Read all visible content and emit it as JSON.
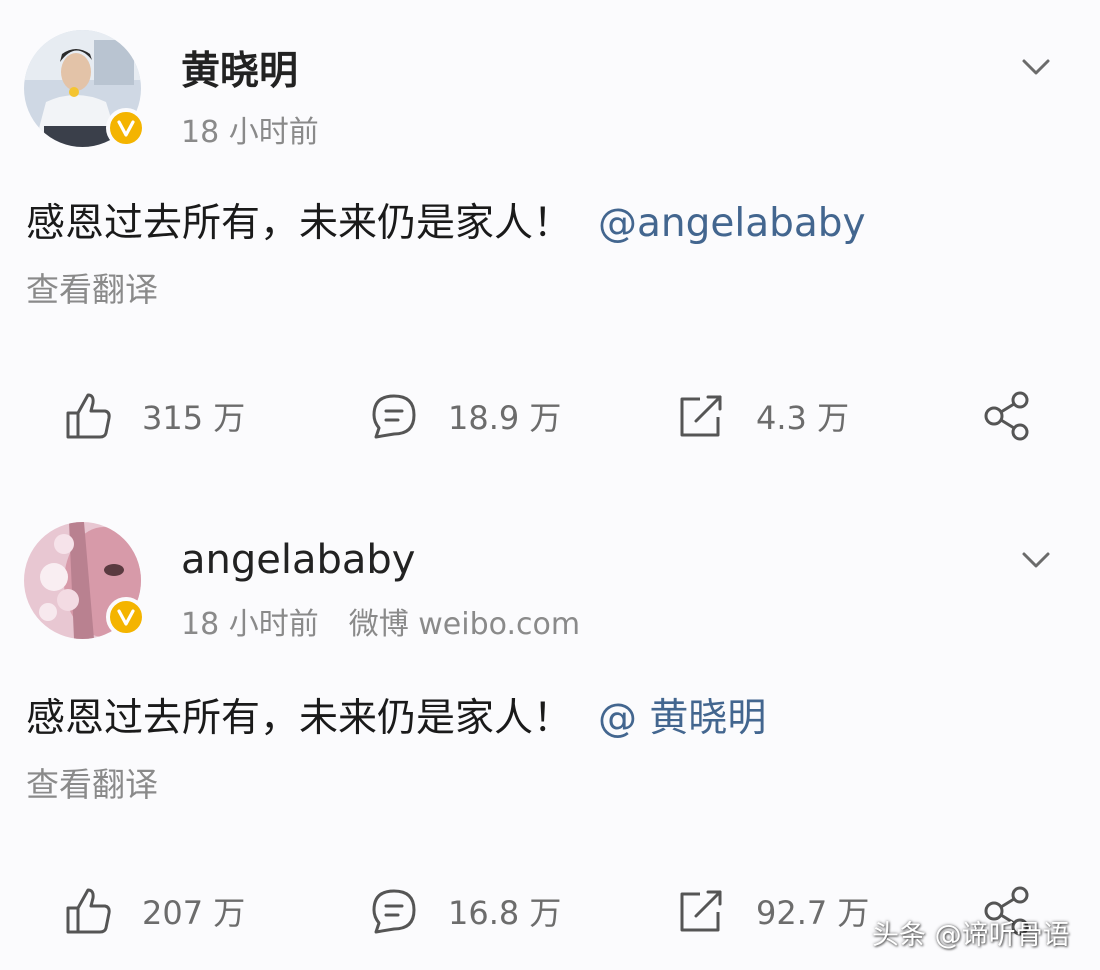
{
  "posts": [
    {
      "username": "黄晓明",
      "time": "18 小时前",
      "source": "",
      "content": "感恩过去所有，未来仍是家人！",
      "mention": "@angelababy",
      "translate_label": "查看翻译",
      "likes": "315 万",
      "comments": "18.9 万",
      "reposts": "4.3 万",
      "avatar_icon": "avatar-photo-man",
      "verified_badge_color": "#f4b400"
    },
    {
      "username": "angelababy",
      "time": "18 小时前",
      "source": "微博 weibo.com",
      "content": "感恩过去所有，未来仍是家人！",
      "mention": "@ 黄晓明",
      "translate_label": "查看翻译",
      "likes": "207 万",
      "comments": "16.8 万",
      "reposts": "92.7 万",
      "avatar_icon": "avatar-photo-woman",
      "verified_badge_color": "#f4b400"
    }
  ],
  "icons": {
    "like": "thumbs-up-icon",
    "comment": "comment-bubble-icon",
    "repost": "repost-arrow-icon",
    "share": "share-icon",
    "menu": "chevron-down-icon"
  },
  "colors": {
    "mention": "#43668f",
    "muted_text": "#8a8a8a",
    "badge": "#f4b400"
  },
  "watermark": "头条 @谛听骨语"
}
